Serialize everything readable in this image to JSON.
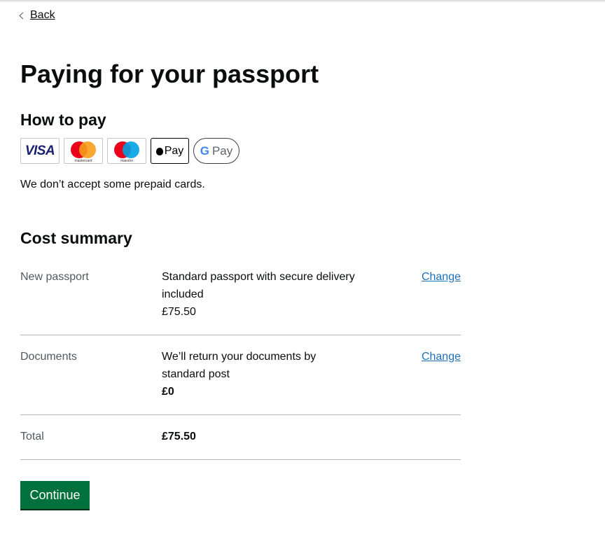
{
  "nav": {
    "back_label": "Back"
  },
  "page": {
    "title": "Paying for your passport"
  },
  "payment": {
    "heading": "How to pay",
    "methods": [
      {
        "name": "visa-logo",
        "text": "VISA"
      },
      {
        "name": "mastercard-logo",
        "text": "mastercard"
      },
      {
        "name": "maestro-logo",
        "text": "maestro"
      },
      {
        "name": "apple-pay-logo",
        "text": "Pay"
      },
      {
        "name": "google-pay-logo",
        "g": "G",
        "text": "Pay"
      }
    ],
    "note": "We don’t accept some prepaid cards."
  },
  "summary": {
    "heading": "Cost summary",
    "rows": [
      {
        "key": "New passport",
        "value_line1": "Standard passport with secure delivery included",
        "value_line2": "£75.50",
        "action": "Change"
      },
      {
        "key": "Documents",
        "value_line1": "We’ll return your documents by standard post",
        "value_line2": "£0",
        "action": "Change"
      },
      {
        "key": "Total",
        "value_line1": "£75.50"
      }
    ]
  },
  "actions": {
    "continue_label": "Continue"
  },
  "colors": {
    "button": "#00703c",
    "link": "#1d70b8",
    "text": "#0b0c0c",
    "secondary_text": "#505a5f"
  }
}
